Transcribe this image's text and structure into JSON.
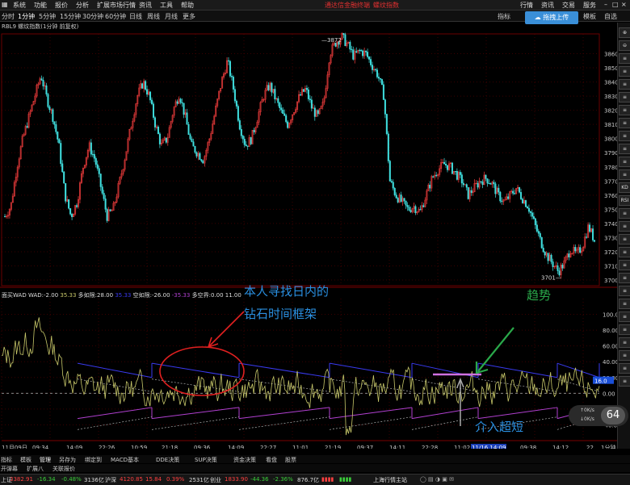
{
  "menubar": {
    "items": [
      "系统",
      "功能",
      "报价",
      "分析",
      "扩展市场行情",
      "资讯",
      "工具",
      "帮助"
    ],
    "brand": "通达信金融终端",
    "brand_sub": "螺纹指数",
    "right_items": [
      "行情",
      "资讯",
      "交易",
      "服务"
    ]
  },
  "timebar": {
    "items": [
      "分时",
      "1分钟",
      "5分钟",
      "15分钟",
      "30分钟",
      "60分钟",
      "日线",
      "周线",
      "月线",
      "更多"
    ],
    "right_items": [
      "指标",
      "模板",
      "自选"
    ]
  },
  "upload_button": "拖拽上传",
  "chart_title": "RBL9 螺纹指数(1分钟 前复权)",
  "wad_header": {
    "name": "面买WAD",
    "wad_label": "WAD:",
    "wad_val": "-2.00",
    "ma_val": "35.33",
    "long_label": "多如限:",
    "long_val": "28.00",
    "v2": "35.33",
    "short_label": "空如限:",
    "short_val": "-26.00",
    "v4": "-35.33",
    "ls_label": "多空界:",
    "ls_val": "0.00",
    "v6": "11.00"
  },
  "annotations": {
    "a1_line1": "本人寻找日内的",
    "a1_line2": "钻石时间框架",
    "a2": "趋势",
    "a3": "介入超短"
  },
  "speed_num": "64",
  "speed_kbps_1": "0K/s",
  "speed_kbps_2": "0K/s",
  "bottom_tabs": [
    "指标",
    "模板",
    "管理",
    "另存为",
    "绑定到",
    "MACD基本",
    "DDE决策",
    "SUP决策",
    "资金决策",
    "看盘",
    "股票"
  ],
  "bottom_tabs2": [
    "开弹幕",
    "扩展八",
    "关联报价"
  ],
  "right_sidebar": [
    "⊕",
    "⊖",
    "≡",
    "≡",
    "≡",
    "≡",
    "≡",
    "≡",
    "≡",
    "≡",
    "≡",
    "≡",
    "KD",
    "RSI",
    "≡",
    "≡",
    "≡",
    "≡",
    "≡",
    "≡",
    "≡",
    "≡",
    "≡",
    "≡",
    "≡",
    "≡",
    "≡",
    "≡"
  ],
  "statusbar": {
    "sh_label": "上证",
    "sh_val": "3382.91",
    "sh_chg": "-16.34",
    "sh_pct": "-0.48%",
    "sh_amt": "3136亿",
    "hs_label": "沪深",
    "hs_val": "4120.85",
    "hs_chg": "15.84",
    "hs_pct": "0.39%",
    "hs_amt": "2531亿",
    "cy_label": "创业",
    "cy_val": "1833.90",
    "cy_chg": "-44.36",
    "cy_pct": "-2.36%",
    "cy_amt": "876.7亿",
    "server": "上海行情主站"
  },
  "colors": {
    "up": "#ff4040",
    "down": "#40e0e0",
    "wad_line": "#c8c86a",
    "upper_band": "#3a3af0",
    "lower_band": "#b040d0",
    "annotation_blue": "#2a8fe0",
    "annotation_green": "#2aa84a",
    "circle_red": "#e02020"
  },
  "chart_data": [
    {
      "type": "line",
      "title": "RBL9 螺纹指数(1分钟 前复权)",
      "ylim": [
        3700,
        3870
      ],
      "y_ticks": [
        3860,
        3850,
        3840,
        3830,
        3820,
        3810,
        3800,
        3790,
        3780,
        3770,
        3760,
        3750,
        3740,
        3730,
        3720,
        3710,
        3700
      ],
      "high_label": "3872",
      "low_label": "3701",
      "price_path": [
        3745,
        3752,
        3780,
        3800,
        3815,
        3830,
        3845,
        3828,
        3815,
        3795,
        3760,
        3745,
        3755,
        3780,
        3795,
        3785,
        3765,
        3745,
        3750,
        3768,
        3788,
        3810,
        3830,
        3840,
        3830,
        3810,
        3795,
        3800,
        3820,
        3832,
        3815,
        3795,
        3790,
        3785,
        3800,
        3820,
        3840,
        3855,
        3835,
        3810,
        3795,
        3800,
        3815,
        3830,
        3838,
        3828,
        3818,
        3810,
        3820,
        3830,
        3835,
        3822,
        3815,
        3825,
        3860,
        3868,
        3872,
        3866,
        3858,
        3862,
        3860,
        3852,
        3845,
        3830,
        3770,
        3760,
        3755,
        3750,
        3752,
        3748,
        3760,
        3772,
        3778,
        3782,
        3780,
        3775,
        3770,
        3760,
        3765,
        3770,
        3772,
        3768,
        3760,
        3755,
        3760,
        3765,
        3758,
        3752,
        3740,
        3728,
        3718,
        3712,
        3706,
        3712,
        3722,
        3718,
        3724,
        3738,
        3728
      ]
    },
    {
      "type": "line",
      "title": "面买WAD",
      "ylim": [
        -60,
        120
      ],
      "y_ticks": [
        100.0,
        80.0,
        60.0,
        40.0,
        20.0,
        0.0,
        -20.0,
        -40.0
      ],
      "highlight_value": "16.0",
      "x_tick_labels": [
        "11月09日",
        "09:34",
        "14:09",
        "22:26",
        "10:59",
        "21:18",
        "09:36",
        "14:09",
        "22:27",
        "11:01",
        "21:19",
        "09:37",
        "14:11",
        "22:28",
        "11:02",
        "11/16 14:09",
        "09:38",
        "14:12",
        "22"
      ]
    }
  ]
}
